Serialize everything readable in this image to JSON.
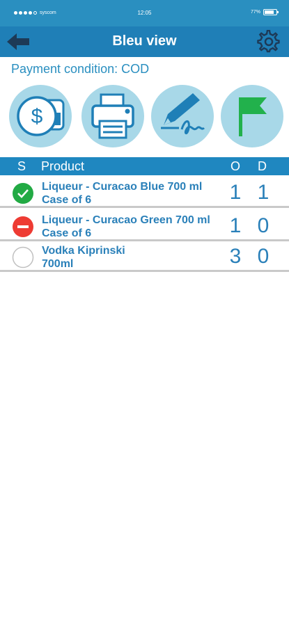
{
  "status_bar": {
    "carrier": "syscom",
    "time": "12:05",
    "battery": "77%"
  },
  "nav": {
    "title": "Bleu view",
    "back_icon": "back-arrow-icon",
    "settings_icon": "gear-icon"
  },
  "payment_condition": "Payment condition: COD",
  "actions": [
    {
      "icon": "payment-icon"
    },
    {
      "icon": "printer-icon"
    },
    {
      "icon": "signature-icon"
    },
    {
      "icon": "flag-icon"
    }
  ],
  "table": {
    "headers": {
      "s": "S",
      "product": "Product",
      "o": "O",
      "d": "D"
    },
    "rows": [
      {
        "status": "ok",
        "line1": "Liqueur - Curacao Blue 700 ml",
        "line2": "Case of 6",
        "o": "1",
        "d": "1"
      },
      {
        "status": "error",
        "line1": "Liqueur - Curacao Green 700 ml",
        "line2": "Case of 6",
        "o": "1",
        "d": "0"
      },
      {
        "status": "empty",
        "line1": "Vodka Kiprinski",
        "line2": "700ml",
        "o": "3",
        "d": "0"
      }
    ]
  },
  "colors": {
    "navbar": "#1f7fb7",
    "statusbar": "#2a8fc0",
    "action_circle": "#a8d8e8",
    "ok": "#22aa44",
    "error": "#ee3b33",
    "flag": "#22b14c"
  }
}
